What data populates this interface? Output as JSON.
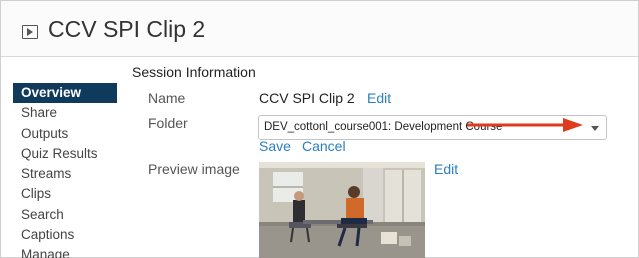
{
  "header": {
    "title": "CCV SPI Clip 2",
    "icon": "session-icon"
  },
  "sidebar": {
    "items": [
      {
        "label": "Overview",
        "active": true
      },
      {
        "label": "Share"
      },
      {
        "label": "Outputs"
      },
      {
        "label": "Quiz Results"
      },
      {
        "label": "Streams"
      },
      {
        "label": "Clips"
      },
      {
        "label": "Search"
      },
      {
        "label": "Captions"
      },
      {
        "label": "Manage"
      }
    ]
  },
  "main": {
    "section_title": "Session Information",
    "name": {
      "label": "Name",
      "value": "CCV SPI  Clip 2",
      "edit": "Edit"
    },
    "folder": {
      "label": "Folder",
      "value": "DEV_cottonl_course001: Development Course",
      "save": "Save",
      "cancel": "Cancel"
    },
    "preview": {
      "label": "Preview image",
      "edit": "Edit"
    }
  },
  "colors": {
    "accent": "#2a7fc0",
    "nav_active": "#0f3a5c",
    "annotation_arrow": "#e03a1e"
  }
}
